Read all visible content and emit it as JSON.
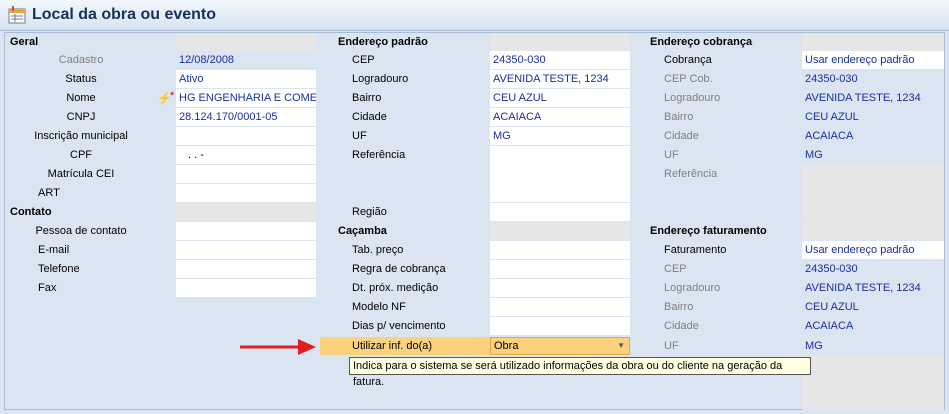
{
  "window": {
    "title": "Local da obra ou evento"
  },
  "sections": {
    "geral": "Geral",
    "contato": "Contato",
    "endereco_padrao": "Endereço padrão",
    "cacamba": "Caçamba",
    "endereco_cobranca": "Endereço cobrança",
    "endereco_faturamento": "Endereço faturamento"
  },
  "geral": {
    "cadastro_label": "Cadastro",
    "cadastro": "12/08/2008",
    "status_label": "Status",
    "status": "Ativo",
    "nome_label": "Nome",
    "nome": "HG ENGENHARIA E COMERC",
    "cnpj_label": "CNPJ",
    "cnpj": "28.124.170/0001-05",
    "insc_label": "Inscrição municipal",
    "cpf_label": "CPF",
    "cpf": ". . -",
    "matricula_label": "Matrícula CEI",
    "art_label": "ART"
  },
  "contato": {
    "pessoa_label": "Pessoa de contato",
    "email_label": "E-mail",
    "telefone_label": "Telefone",
    "fax_label": "Fax"
  },
  "endereco_padrao": {
    "cep_label": "CEP",
    "cep": "24350-030",
    "logradouro_label": "Logradouro",
    "logradouro": "AVENIDA TESTE, 1234",
    "bairro_label": "Bairro",
    "bairro": "CEU AZUL",
    "cidade_label": "Cidade",
    "cidade": "ACAIACA",
    "uf_label": "UF",
    "uf": "MG",
    "referencia_label": "Referência",
    "regiao_label": "Região"
  },
  "cacamba": {
    "tab_preco_label": "Tab. preço",
    "regra_label": "Regra de cobrança",
    "dt_label": "Dt. próx. medição",
    "modelo_label": "Modelo NF",
    "dias_label": "Dias p/ vencimento",
    "utilizar_label": "Utilizar inf. do(a)",
    "utilizar_value": "Obra"
  },
  "endereco_cobranca": {
    "cobranca_label": "Cobrança",
    "cobranca": "Usar endereço padrão",
    "cep_label": "CEP Cob.",
    "cep": "24350-030",
    "logradouro_label": "Logradouro",
    "logradouro": "AVENIDA TESTE, 1234",
    "bairro_label": "Bairro",
    "bairro": "CEU AZUL",
    "cidade_label": "Cidade",
    "cidade": "ACAIACA",
    "uf_label": "UF",
    "uf": "MG",
    "referencia_label": "Referência"
  },
  "endereco_faturamento": {
    "faturamento_label": "Faturamento",
    "faturamento": "Usar endereço padrão",
    "cep_label": "CEP",
    "cep": "24350-030",
    "logradouro_label": "Logradouro",
    "logradouro": "AVENIDA TESTE, 1234",
    "bairro_label": "Bairro",
    "bairro": "CEU AZUL",
    "cidade_label": "Cidade",
    "cidade": "ACAIACA",
    "uf_label": "UF",
    "uf": "MG"
  },
  "tooltip": "Indica para o sistema se será utilizado informações da obra ou do cliente na geração da fatura."
}
